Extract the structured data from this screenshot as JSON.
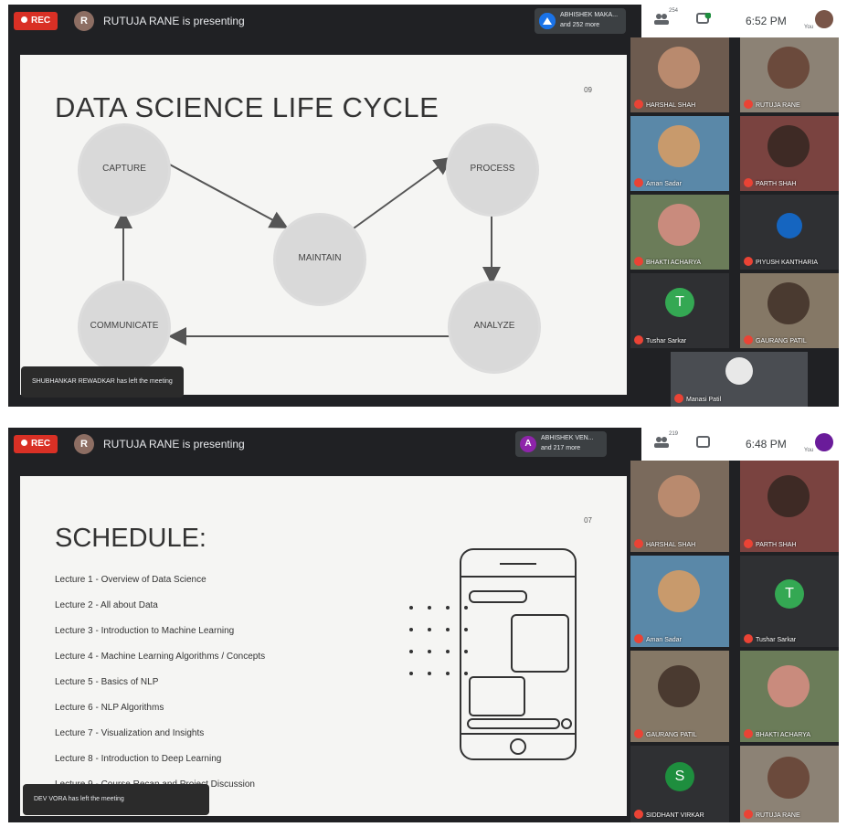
{
  "shot1": {
    "rec_label": "REC",
    "presenter_initial": "R",
    "presenter_text": "RUTUJA RANE is presenting",
    "viewer_initial": "",
    "viewer_line1": "ABHISHEK MAKA...",
    "viewer_line2": "and 252 more",
    "people_count": "254",
    "time": "6:52 PM",
    "you_label": "You",
    "slide": {
      "number": "09",
      "title": "DATA SCIENCE LIFE CYCLE",
      "nodes": {
        "capture": "CAPTURE",
        "maintain": "MAINTAIN",
        "process": "PROCESS",
        "analyze": "ANALYZE",
        "communicate": "COMMUNICATE"
      }
    },
    "toast": "SHUBHANKAR REWADKAR has left the meeting",
    "participants": [
      {
        "name": "HARSHAL SHAH"
      },
      {
        "name": "RUTUJA RANE"
      },
      {
        "name": "Aman Sadar"
      },
      {
        "name": "PARTH SHAH"
      },
      {
        "name": "BHAKTI ACHARYA"
      },
      {
        "name": "PIYUSH KANTHARIA"
      },
      {
        "name": "Tushar Sarkar",
        "initial": "T"
      },
      {
        "name": "GAURANG PATIL"
      },
      {
        "name": "Manasi Patil"
      }
    ]
  },
  "shot2": {
    "rec_label": "REC",
    "presenter_initial": "R",
    "presenter_text": "RUTUJA RANE is presenting",
    "viewer_initial": "A",
    "viewer_line1": "ABHISHEK VEN...",
    "viewer_line2": "and 217 more",
    "people_count": "219",
    "time": "6:48 PM",
    "you_label": "You",
    "slide": {
      "number": "07",
      "title": "SCHEDULE:",
      "lectures": [
        "Lecture 1 - Overview of Data Science",
        "Lecture 2 - All about Data",
        "Lecture 3 - Introduction to Machine Learning",
        "Lecture 4 - Machine Learning Algorithms / Concepts",
        "Lecture 5 - Basics of NLP",
        "Lecture 6 - NLP Algorithms",
        "Lecture 7 - Visualization and Insights",
        "Lecture 8 - Introduction to Deep Learning",
        "Lecture 9 - Course Recap and Project Discussion"
      ]
    },
    "toast": "DEV VORA has left the meeting",
    "participants": [
      {
        "name": "HARSHAL SHAH"
      },
      {
        "name": "PARTH SHAH"
      },
      {
        "name": "Aman Sadar"
      },
      {
        "name": "Tushar Sarkar",
        "initial": "T"
      },
      {
        "name": "GAURANG PATIL"
      },
      {
        "name": "BHAKTI ACHARYA"
      },
      {
        "name": "SIDDHANT VIRKAR",
        "initial": "S"
      },
      {
        "name": "RUTUJA RANE"
      }
    ]
  },
  "colors": {
    "rec": "#d93025",
    "meet_dark": "#202124",
    "slide_bg": "#f5f5f3",
    "blob": "#d9d9d9",
    "tushar_avatar": "#34a853",
    "siddhant_avatar": "#1e8e3e",
    "viewer_avatar_2": "#8e24aa"
  }
}
